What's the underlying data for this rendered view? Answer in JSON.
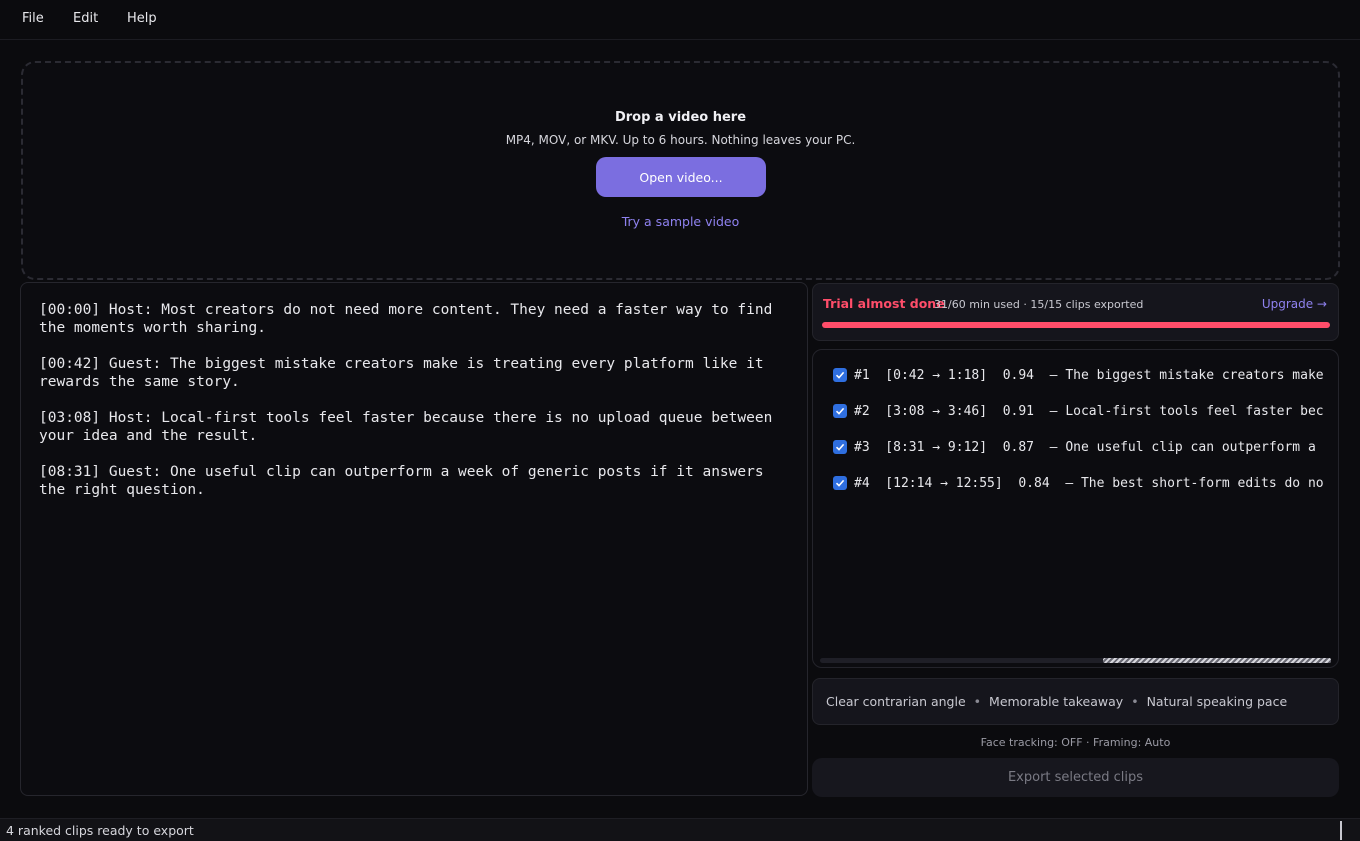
{
  "menu": {
    "file": "File",
    "edit": "Edit",
    "help": "Help"
  },
  "dropzone": {
    "title": "Drop a video here",
    "subtitle": "MP4, MOV, or MKV. Up to 6 hours. Nothing leaves your PC.",
    "open_button": "Open video...",
    "sample_link": "Try a sample video"
  },
  "transcript": [
    "[00:00] Host: Most creators do not need more content. They need a faster way to find the moments worth sharing.",
    "[00:42] Guest: The biggest mistake creators make is treating every platform like it rewards the same story.",
    "[03:08] Host: Local-first tools feel faster because there is no upload queue between your idea and the result.",
    "[08:31] Guest: One useful clip can outperform a week of generic posts if it answers the right question."
  ],
  "trial": {
    "title": "Trial almost done",
    "stats": "31/60 min used  ·  15/15 clips exported",
    "upgrade": "Upgrade →",
    "progress": 1.0,
    "color": "#ff4d6a"
  },
  "clips": [
    {
      "checked": true,
      "text": "#1  [0:42 → 1:18]  0.94  — The biggest mistake creators make"
    },
    {
      "checked": true,
      "text": "#2  [3:08 → 3:46]  0.91  — Local-first tools feel faster bec"
    },
    {
      "checked": true,
      "text": "#3  [8:31 → 9:12]  0.87  — One useful clip can outperform a"
    },
    {
      "checked": true,
      "text": "#4  [12:14 → 12:55]  0.84  — The best short-form edits do no"
    }
  ],
  "tags": [
    "Clear contrarian angle",
    "Memorable takeaway",
    "Natural speaking pace"
  ],
  "face_status": "Face tracking: OFF · Framing: Auto",
  "export_button": "Export selected clips",
  "status_bar": "4 ranked clips ready to export",
  "colors": {
    "accent": "#7b6ee0",
    "link": "#8f82f0",
    "checkbox": "#2f6fe0",
    "background": "#0b0b0e"
  }
}
